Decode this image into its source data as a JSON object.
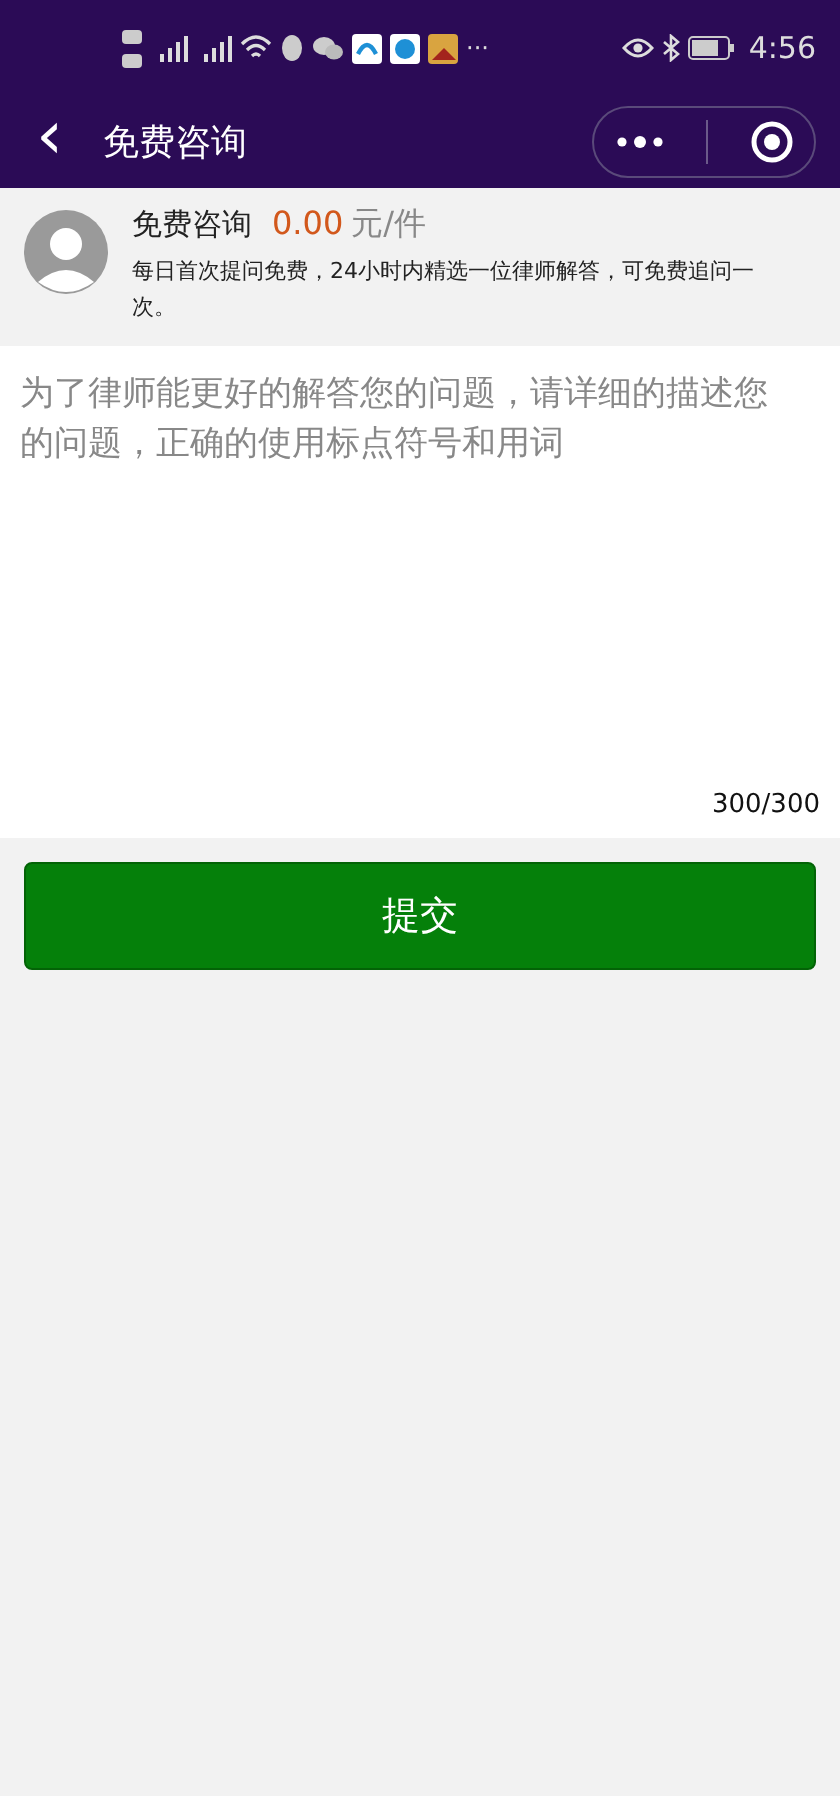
{
  "status_bar": {
    "time": "4:56",
    "more": "···"
  },
  "nav": {
    "back": "‹",
    "title": "免费咨询"
  },
  "service": {
    "name": "免费咨询",
    "price": "0.00",
    "unit": "元/件",
    "description": "每日首次提问免费，24小时内精选一位律师解答，可免费追问一次。"
  },
  "question": {
    "placeholder": "为了律师能更好的解答您的问题，请详细的描述您的问题，正确的使用标点符号和用词",
    "counter": "300/300"
  },
  "submit": "提交"
}
